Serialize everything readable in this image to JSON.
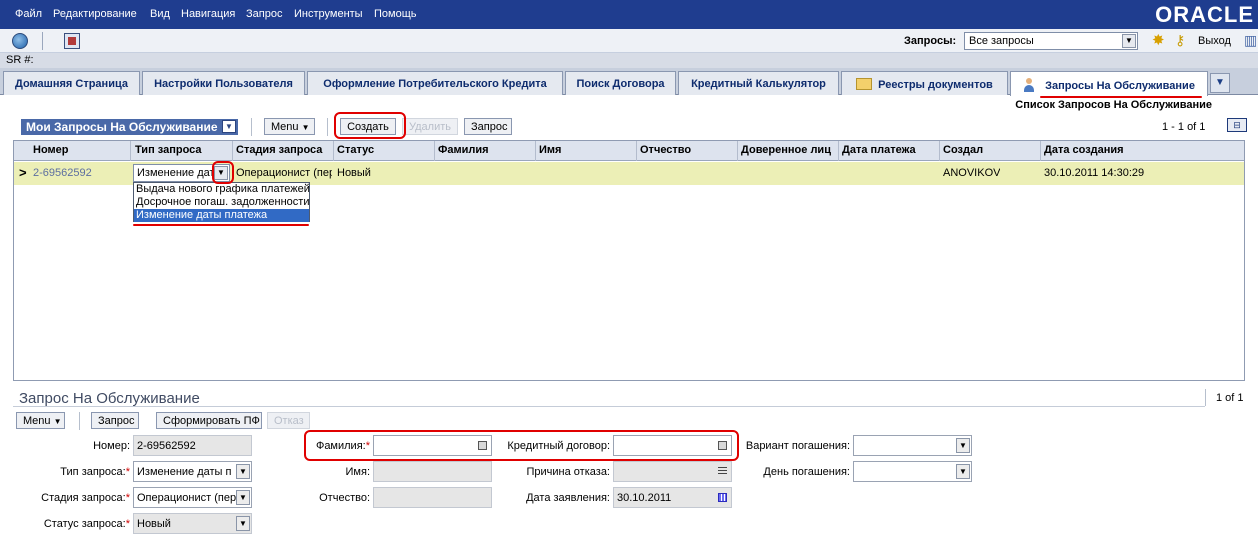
{
  "menu": {
    "items": [
      "Файл",
      "Редактирование",
      "Вид",
      "Навигация",
      "Запрос",
      "Инструменты",
      "Помощь"
    ],
    "logo": "ORACLE"
  },
  "toolbar": {
    "queries_label": "Запросы:",
    "queries_value": "Все запросы",
    "logout_label": "Выход",
    "icons": [
      "globe-icon",
      "report-icon",
      "settings-icon",
      "key-icon",
      "chart-icon"
    ]
  },
  "sr_bar": {
    "label": "SR #:"
  },
  "tabs": [
    {
      "label": "Домашняя Страница"
    },
    {
      "label": "Настройки Пользователя"
    },
    {
      "label": "Оформление Потребительского Кредита"
    },
    {
      "label": "Поиск Договора"
    },
    {
      "label": "Кредитный Калькулятор"
    },
    {
      "label": "Реестры документов"
    },
    {
      "label": "Запросы На Обслуживание"
    }
  ],
  "list_view_title": "Список Запросов На Обслуживание",
  "list_applet": {
    "title": "Мои Запросы На Обслуживание",
    "menu_label": "Menu",
    "create_label": "Создать",
    "delete_label": "Удалить",
    "query_label": "Запрос",
    "records": "1 - 1 of 1",
    "columns": [
      "Номер",
      "Тип запроса",
      "Стадия запроса",
      "Статус",
      "Фамилия",
      "Имя",
      "Отчество",
      "Доверенное лиц",
      "Дата платежа",
      "Создал",
      "Дата создания"
    ],
    "row": {
      "number": "2-69562592",
      "type": "Изменение дат",
      "stage": "Операционист (пер",
      "status": "Новый",
      "created_by": "ANOVIKOV",
      "created_date": "30.10.2011 14:30:29"
    },
    "type_options": [
      "Выдача нового графика платежей",
      "Досрочное погаш. задолженности",
      "Изменение даты платежа"
    ],
    "type_selected_index": 2
  },
  "form_applet": {
    "title": "Запрос На Обслуживание",
    "records": "1 of 1",
    "menu_label": "Menu",
    "query_label": "Запрос",
    "generate_label": "Сформировать ПФ",
    "reject_label": "Отказ",
    "fields": {
      "number_label": "Номер:",
      "number_value": "2-69562592",
      "type_label": "Тип запроса:",
      "type_value": "Изменение даты п",
      "stage_label": "Стадия запроса:",
      "stage_value": "Операционист (пер",
      "status_label": "Статус запроса:",
      "status_value": "Новый",
      "lastname_label": "Фамилия:",
      "firstname_label": "Имя:",
      "middlename_label": "Отчество:",
      "contract_label": "Кредитный договор:",
      "reject_reason_label": "Причина отказа:",
      "request_date_label": "Дата заявления:",
      "request_date_value": "30.10.2011",
      "repayment_label": "Вариант погашения:",
      "payment_day_label": "День погашения:"
    }
  },
  "annotation_color": "#e00000"
}
